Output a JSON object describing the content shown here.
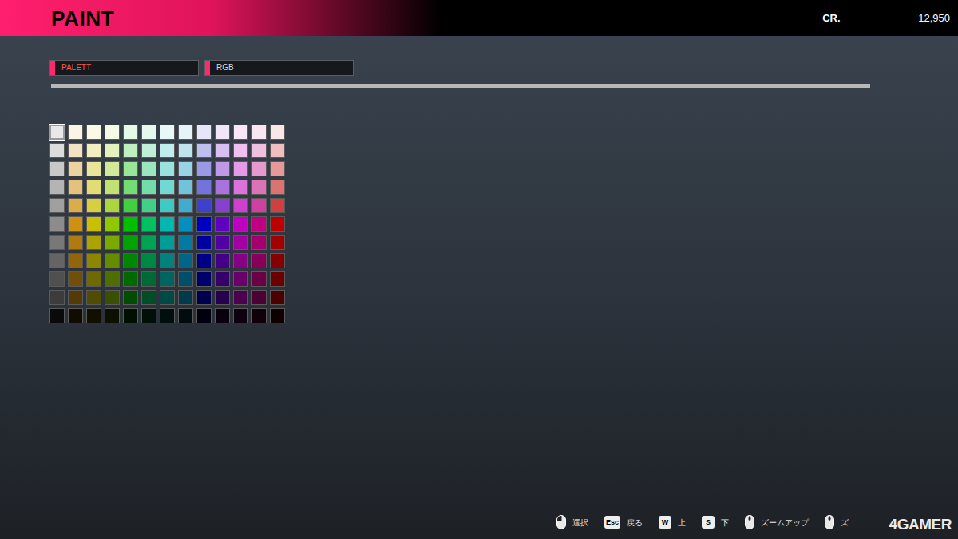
{
  "screen": {
    "title": "PAINT",
    "credits_label": "CR.",
    "credits": "12,950"
  },
  "tabs": [
    {
      "label": "PALETT",
      "selected": true
    },
    {
      "label": "RGB",
      "selected": false
    }
  ],
  "palette": [
    {
      "swatches": [
        {
          "color": "#e8e8e8",
          "selected": true
        },
        {
          "color": "#faf4e7",
          "selected": false
        },
        {
          "color": "#faf9e6",
          "selected": false
        },
        {
          "color": "#f4fae6",
          "selected": false
        },
        {
          "color": "#e6f9e6",
          "selected": false
        },
        {
          "color": "#e6f9ef",
          "selected": false
        },
        {
          "color": "#e6f8f7",
          "selected": false
        },
        {
          "color": "#e6f4f9",
          "selected": false
        },
        {
          "color": "#e6e6f9",
          "selected": false
        },
        {
          "color": "#efe6f9",
          "selected": false
        },
        {
          "color": "#f9e6f9",
          "selected": false
        },
        {
          "color": "#f9e6f2",
          "selected": false
        },
        {
          "color": "#f9e6e6",
          "selected": false
        }
      ]
    },
    {
      "swatches": [
        {
          "color": "#dcdcdc",
          "selected": false
        },
        {
          "color": "#f3e3c3",
          "selected": false
        },
        {
          "color": "#f1efbf",
          "selected": false
        },
        {
          "color": "#e3f1bf",
          "selected": false
        },
        {
          "color": "#bfefbf",
          "selected": false
        },
        {
          "color": "#bfefd7",
          "selected": false
        },
        {
          "color": "#bfedeb",
          "selected": false
        },
        {
          "color": "#bfe3ef",
          "selected": false
        },
        {
          "color": "#bfbfef",
          "selected": false
        },
        {
          "color": "#d7bfef",
          "selected": false
        },
        {
          "color": "#efbfef",
          "selected": false
        },
        {
          "color": "#efbfdf",
          "selected": false
        },
        {
          "color": "#efbfbf",
          "selected": false
        }
      ]
    },
    {
      "swatches": [
        {
          "color": "#c8c8c8",
          "selected": false
        },
        {
          "color": "#ecd39f",
          "selected": false
        },
        {
          "color": "#e9e699",
          "selected": false
        },
        {
          "color": "#d3e999",
          "selected": false
        },
        {
          "color": "#99e699",
          "selected": false
        },
        {
          "color": "#99e6bf",
          "selected": false
        },
        {
          "color": "#99e3df",
          "selected": false
        },
        {
          "color": "#99d3e6",
          "selected": false
        },
        {
          "color": "#9999e6",
          "selected": false
        },
        {
          "color": "#bf99e6",
          "selected": false
        },
        {
          "color": "#e699e6",
          "selected": false
        },
        {
          "color": "#e699cc",
          "selected": false
        },
        {
          "color": "#e69999",
          "selected": false
        }
      ]
    },
    {
      "swatches": [
        {
          "color": "#b4b4b4",
          "selected": false
        },
        {
          "color": "#e5c27c",
          "selected": false
        },
        {
          "color": "#e1dc73",
          "selected": false
        },
        {
          "color": "#c2e173",
          "selected": false
        },
        {
          "color": "#73dc73",
          "selected": false
        },
        {
          "color": "#73dca8",
          "selected": false
        },
        {
          "color": "#73d8d4",
          "selected": false
        },
        {
          "color": "#73c2dc",
          "selected": false
        },
        {
          "color": "#7373dc",
          "selected": false
        },
        {
          "color": "#a873dc",
          "selected": false
        },
        {
          "color": "#dc73dc",
          "selected": false
        },
        {
          "color": "#dc73b9",
          "selected": false
        },
        {
          "color": "#dc7373",
          "selected": false
        }
      ]
    },
    {
      "swatches": [
        {
          "color": "#a0a0a0",
          "selected": false
        },
        {
          "color": "#dcac4c",
          "selected": false
        },
        {
          "color": "#d6d040",
          "selected": false
        },
        {
          "color": "#acd640",
          "selected": false
        },
        {
          "color": "#40d040",
          "selected": false
        },
        {
          "color": "#40d088",
          "selected": false
        },
        {
          "color": "#40cac4",
          "selected": false
        },
        {
          "color": "#40acd0",
          "selected": false
        },
        {
          "color": "#4040d0",
          "selected": false
        },
        {
          "color": "#8840d0",
          "selected": false
        },
        {
          "color": "#d040d0",
          "selected": false
        },
        {
          "color": "#d040a0",
          "selected": false
        },
        {
          "color": "#d04040",
          "selected": false
        }
      ]
    },
    {
      "swatches": [
        {
          "color": "#8c8c8c",
          "selected": false
        },
        {
          "color": "#d09010",
          "selected": false
        },
        {
          "color": "#c8c000",
          "selected": false
        },
        {
          "color": "#90c800",
          "selected": false
        },
        {
          "color": "#00c000",
          "selected": false
        },
        {
          "color": "#00c060",
          "selected": false
        },
        {
          "color": "#00b8b0",
          "selected": false
        },
        {
          "color": "#0090c0",
          "selected": false
        },
        {
          "color": "#0000c0",
          "selected": false
        },
        {
          "color": "#6000c0",
          "selected": false
        },
        {
          "color": "#c000c0",
          "selected": false
        },
        {
          "color": "#c00080",
          "selected": false
        },
        {
          "color": "#c00000",
          "selected": false
        }
      ]
    },
    {
      "swatches": [
        {
          "color": "#787878",
          "selected": false
        },
        {
          "color": "#b17a0e",
          "selected": false
        },
        {
          "color": "#aaa300",
          "selected": false
        },
        {
          "color": "#7aaa00",
          "selected": false
        },
        {
          "color": "#00a300",
          "selected": false
        },
        {
          "color": "#00a352",
          "selected": false
        },
        {
          "color": "#009c96",
          "selected": false
        },
        {
          "color": "#007aa3",
          "selected": false
        },
        {
          "color": "#0000a3",
          "selected": false
        },
        {
          "color": "#5200a3",
          "selected": false
        },
        {
          "color": "#a300a3",
          "selected": false
        },
        {
          "color": "#a3006d",
          "selected": false
        },
        {
          "color": "#a30000",
          "selected": false
        }
      ]
    },
    {
      "swatches": [
        {
          "color": "#646464",
          "selected": false
        },
        {
          "color": "#92650b",
          "selected": false
        },
        {
          "color": "#8c8600",
          "selected": false
        },
        {
          "color": "#658c00",
          "selected": false
        },
        {
          "color": "#008600",
          "selected": false
        },
        {
          "color": "#008643",
          "selected": false
        },
        {
          "color": "#00817b",
          "selected": false
        },
        {
          "color": "#006586",
          "selected": false
        },
        {
          "color": "#000086",
          "selected": false
        },
        {
          "color": "#430086",
          "selected": false
        },
        {
          "color": "#860086",
          "selected": false
        },
        {
          "color": "#86005a",
          "selected": false
        },
        {
          "color": "#860000",
          "selected": false
        }
      ]
    },
    {
      "swatches": [
        {
          "color": "#505050",
          "selected": false
        },
        {
          "color": "#724f09",
          "selected": false
        },
        {
          "color": "#6e6a00",
          "selected": false
        },
        {
          "color": "#4f6e00",
          "selected": false
        },
        {
          "color": "#006a00",
          "selected": false
        },
        {
          "color": "#006a35",
          "selected": false
        },
        {
          "color": "#006561",
          "selected": false
        },
        {
          "color": "#004f6a",
          "selected": false
        },
        {
          "color": "#00006a",
          "selected": false
        },
        {
          "color": "#35006a",
          "selected": false
        },
        {
          "color": "#6a006a",
          "selected": false
        },
        {
          "color": "#6a0046",
          "selected": false
        },
        {
          "color": "#6a0000",
          "selected": false
        }
      ]
    },
    {
      "swatches": [
        {
          "color": "#3c3c3c",
          "selected": false
        },
        {
          "color": "#533a06",
          "selected": false
        },
        {
          "color": "#504d00",
          "selected": false
        },
        {
          "color": "#3a5000",
          "selected": false
        },
        {
          "color": "#004d00",
          "selected": false
        },
        {
          "color": "#004d26",
          "selected": false
        },
        {
          "color": "#004a46",
          "selected": false
        },
        {
          "color": "#003a4d",
          "selected": false
        },
        {
          "color": "#00004d",
          "selected": false
        },
        {
          "color": "#26004d",
          "selected": false
        },
        {
          "color": "#4d004d",
          "selected": false
        },
        {
          "color": "#4d0033",
          "selected": false
        },
        {
          "color": "#4d0000",
          "selected": false
        }
      ]
    },
    {
      "swatches": [
        {
          "color": "#0a0a0a",
          "selected": false
        },
        {
          "color": "#110c01",
          "selected": false
        },
        {
          "color": "#100f00",
          "selected": false
        },
        {
          "color": "#0c1000",
          "selected": false
        },
        {
          "color": "#000f00",
          "selected": false
        },
        {
          "color": "#000f08",
          "selected": false
        },
        {
          "color": "#000f0e",
          "selected": false
        },
        {
          "color": "#000c0f",
          "selected": false
        },
        {
          "color": "#00000f",
          "selected": false
        },
        {
          "color": "#08000f",
          "selected": false
        },
        {
          "color": "#0f000f",
          "selected": false
        },
        {
          "color": "#0f000a",
          "selected": false
        },
        {
          "color": "#0f0000",
          "selected": false
        }
      ]
    }
  ],
  "hints": [
    {
      "kind": "mouse",
      "label": "選択"
    },
    {
      "kind": "key",
      "key": "Esc",
      "label": "戻る"
    },
    {
      "kind": "key",
      "key": "W",
      "label": "上"
    },
    {
      "kind": "key",
      "key": "S",
      "label": "下"
    },
    {
      "kind": "wheel",
      "label": "ズームアップ"
    },
    {
      "kind": "wheel",
      "label": "ズ"
    }
  ],
  "watermark": "4GAMER"
}
